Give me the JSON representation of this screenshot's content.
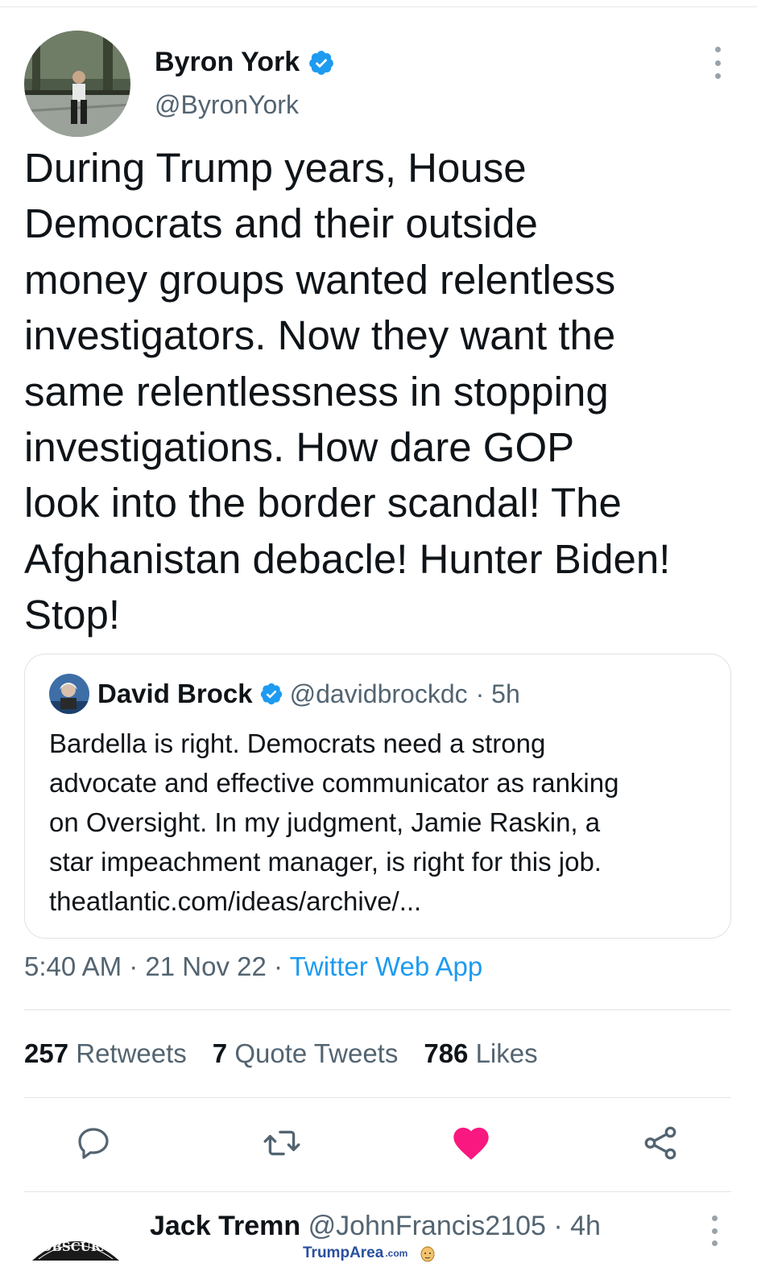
{
  "tweet": {
    "author": {
      "display_name": "Byron York",
      "handle": "@ByronYork",
      "verified": true
    },
    "text": "During Trump years, House\nDemocrats and their outside\nmoney groups wanted relentless\ninvestigators. Now they want the\nsame relentlessness in stopping\ninvestigations. How dare GOP\nlook into the border scandal! The\nAfghanistan debacle! Hunter Biden!\nStop!",
    "quoted": {
      "display_name": "David Brock",
      "handle": "@davidbrockdc",
      "time": "· 5h",
      "verified": true,
      "text": "Bardella is right. Democrats need a strong\nadvocate and effective communicator as ranking\non Oversight. In my judgment, Jamie Raskin, a\nstar impeachment manager, is right for this job.\ntheatlantic.com/ideas/archive/..."
    },
    "timestamp": "5:40 AM · 21 Nov 22 · ",
    "source": "Twitter Web App",
    "stats": {
      "retweets_count": "257",
      "retweets_label": "Retweets",
      "quotes_count": "7",
      "quotes_label": "Quote Tweets",
      "likes_count": "786",
      "likes_label": "Likes"
    },
    "liked": true
  },
  "reply": {
    "display_name": "Jack Tremn",
    "handle": "@JohnFrancis2105",
    "time": "· 4h",
    "avatar_text": "OBSCURA"
  },
  "watermark": {
    "brand_a": "Trump",
    "brand_b": "Area",
    "suffix": ".com"
  },
  "colors": {
    "accent_blue": "#1d9bf0",
    "like_pink": "#f91880",
    "secondary_text": "#536471"
  },
  "icons": [
    "more-vertical-icon",
    "verified-badge-icon",
    "reply-icon",
    "retweet-icon",
    "like-heart-icon",
    "share-icon"
  ]
}
